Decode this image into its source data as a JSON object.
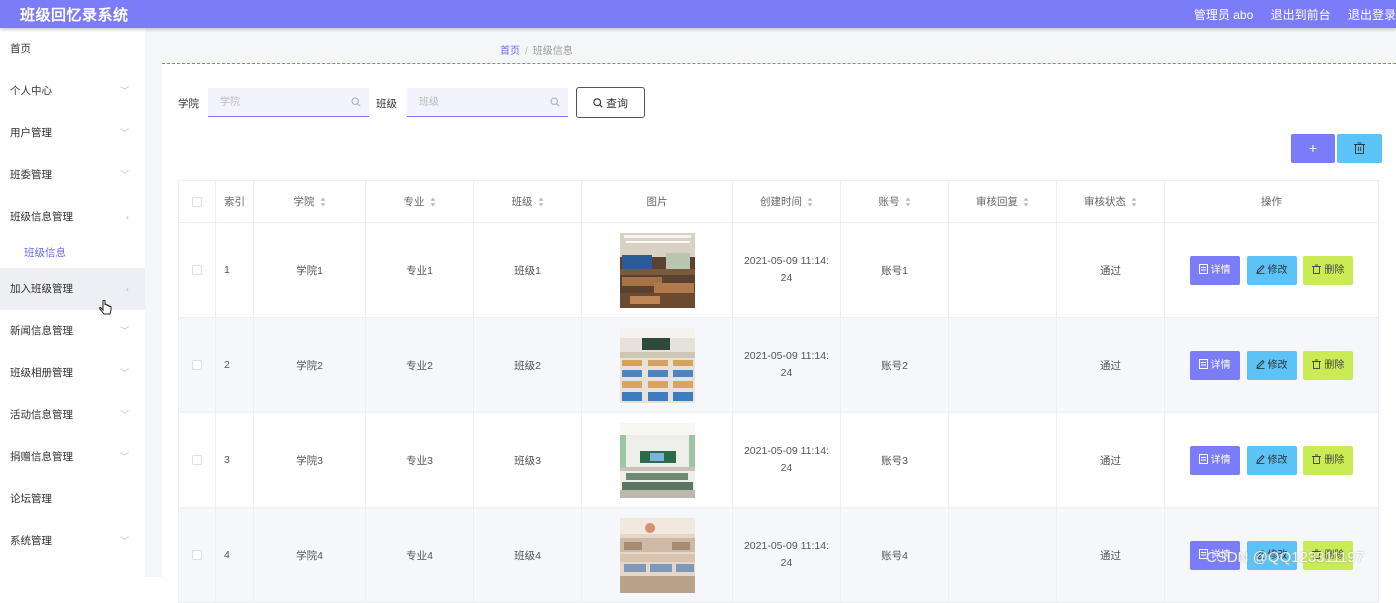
{
  "header": {
    "app_title": "班级回忆录系统",
    "admin": "管理员 abo",
    "link_front": "退出到前台",
    "link_logout": "退出登录"
  },
  "sidebar": {
    "items": [
      {
        "label": "首页"
      },
      {
        "label": "个人中心"
      },
      {
        "label": "用户管理"
      },
      {
        "label": "班委管理"
      },
      {
        "label": "班级信息管理"
      },
      {
        "label": "加入班级管理"
      },
      {
        "label": "新闻信息管理"
      },
      {
        "label": "班级相册管理"
      },
      {
        "label": "活动信息管理"
      },
      {
        "label": "捐赠信息管理"
      },
      {
        "label": "论坛管理"
      },
      {
        "label": "系统管理"
      }
    ],
    "sub_item": "班级信息"
  },
  "breadcrumb": {
    "home": "首页",
    "current": "班级信息"
  },
  "search": {
    "college_label": "学院",
    "college_placeholder": "学院",
    "class_label": "班级",
    "class_placeholder": "班级",
    "query_button": "查询"
  },
  "table": {
    "headers": [
      "索引",
      "学院",
      "专业",
      "班级",
      "图片",
      "创建时间",
      "账号",
      "审核回复",
      "审核状态",
      "操作"
    ],
    "rows": [
      {
        "index": "1",
        "college": "学院1",
        "major": "专业1",
        "class": "班级1",
        "time1": "2021-05-09 11:14:",
        "time2": "24",
        "account": "账号1",
        "reply": "",
        "status": "通过"
      },
      {
        "index": "2",
        "college": "学院2",
        "major": "专业2",
        "class": "班级2",
        "time1": "2021-05-09 11:14:",
        "time2": "24",
        "account": "账号2",
        "reply": "",
        "status": "通过"
      },
      {
        "index": "3",
        "college": "学院3",
        "major": "专业3",
        "class": "班级3",
        "time1": "2021-05-09 11:14:",
        "time2": "24",
        "account": "账号3",
        "reply": "",
        "status": "通过"
      },
      {
        "index": "4",
        "college": "学院4",
        "major": "专业4",
        "class": "班级4",
        "time1": "2021-05-09 11:14:",
        "time2": "24",
        "account": "账号4",
        "reply": "",
        "status": "通过"
      }
    ],
    "actions": {
      "detail": "详情",
      "edit": "修改",
      "delete": "删除"
    }
  },
  "watermark": "CSDN @QQ123311197",
  "colors": {
    "primary": "#7b7cf7",
    "info": "#5cc3f7",
    "danger": "#c9ec54"
  }
}
